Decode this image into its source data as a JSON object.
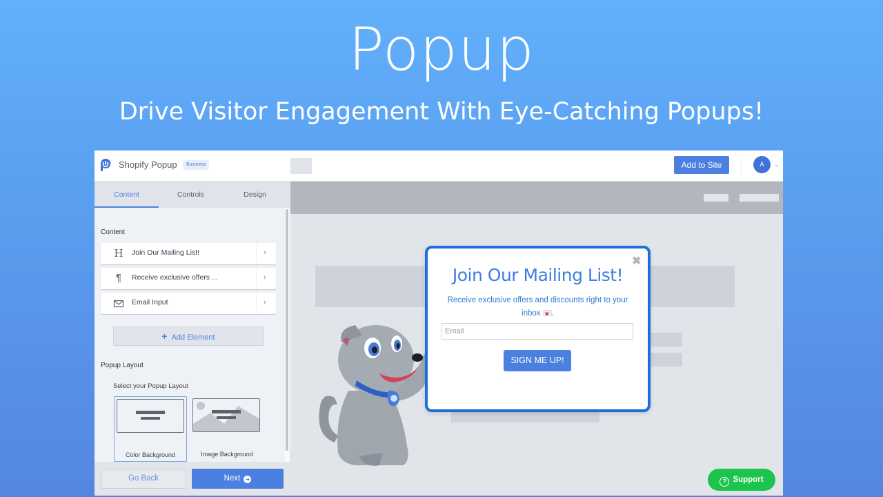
{
  "hero": {
    "title": "Popup",
    "subtitle": "Drive Visitor Engagement With Eye-Catching Popups!"
  },
  "topbar": {
    "app_name": "Shopify Popup",
    "plan_badge": "Business",
    "add_to_site_label": "Add to Site",
    "avatar_initial": "A",
    "avatar_chevron": "⌄"
  },
  "sidebar": {
    "tabs": [
      {
        "label": "Content",
        "active": true
      },
      {
        "label": "Controls",
        "active": false
      },
      {
        "label": "Design",
        "active": false
      }
    ],
    "content_heading": "Content",
    "elements": [
      {
        "icon": "heading-icon",
        "glyph": "H",
        "label": "Join Our Mailing List!"
      },
      {
        "icon": "paragraph-icon",
        "glyph": "¶",
        "label": "Receive exclusive offers ..."
      },
      {
        "icon": "envelope-icon",
        "glyph": "✉",
        "label": "Email Input"
      }
    ],
    "chevron": "›",
    "add_element_label": "Add Element",
    "add_element_plus": "+",
    "layout_heading": "Popup Layout",
    "layout_hint": "Select your Popup Layout",
    "layouts": [
      {
        "label": "Color Background",
        "selected": true
      },
      {
        "label": "Image Background",
        "selected": false
      }
    ],
    "go_back_label": "Go Back",
    "next_label": "Next",
    "next_icon": "➔"
  },
  "popup": {
    "title": "Join Our Mailing List!",
    "text": "Receive exclusive offers and discounts right to your inbox",
    "text_end": ".",
    "email_placeholder": "Email",
    "submit_label": "SIGN ME UP!",
    "close_glyph": "✖"
  },
  "support": {
    "label": "Support",
    "icon_glyph": "?"
  },
  "colors": {
    "accent": "#4c80e0",
    "popup_border": "#1b6fdc",
    "support_green": "#1cc44e"
  }
}
